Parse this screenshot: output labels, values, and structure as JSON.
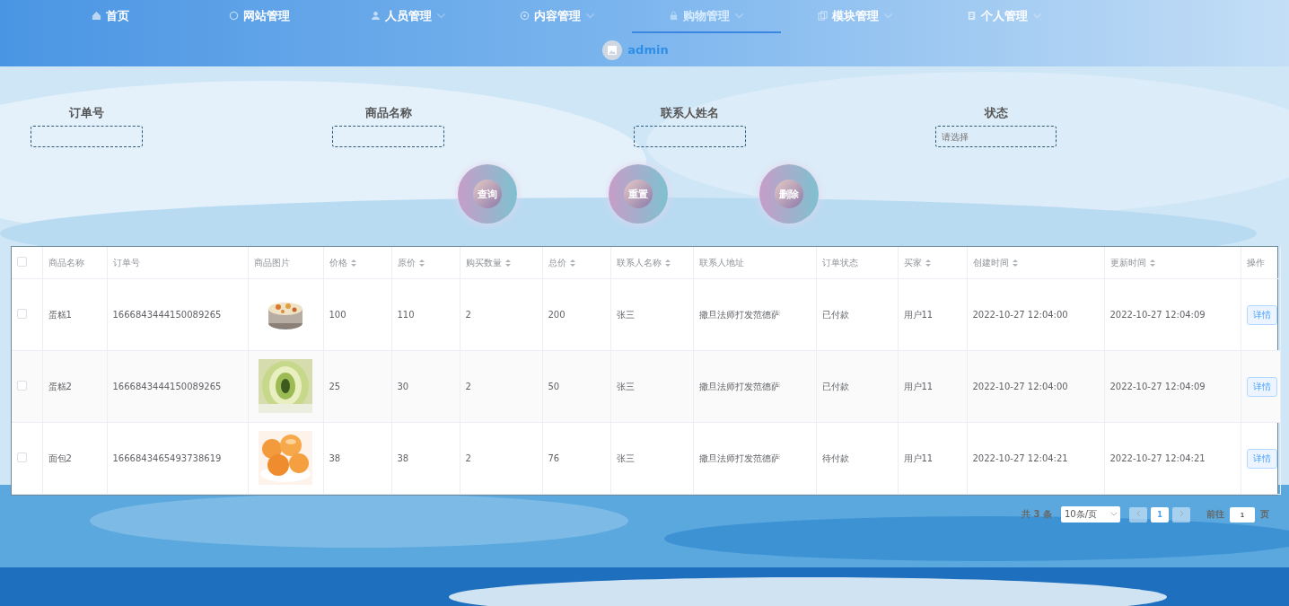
{
  "nav": {
    "items": [
      {
        "label": "首页",
        "dropdown": false,
        "selected": false
      },
      {
        "label": "网站管理",
        "dropdown": false,
        "selected": false
      },
      {
        "label": "人员管理",
        "dropdown": true,
        "selected": false
      },
      {
        "label": "内容管理",
        "dropdown": true,
        "selected": false
      },
      {
        "label": "购物管理",
        "dropdown": true,
        "selected": true
      },
      {
        "label": "模块管理",
        "dropdown": true,
        "selected": false
      },
      {
        "label": "个人管理",
        "dropdown": true,
        "selected": false
      }
    ],
    "user": "admin"
  },
  "filters": [
    {
      "label": "订单号",
      "kind": "input"
    },
    {
      "label": "商品名称",
      "kind": "input"
    },
    {
      "label": "联系人姓名",
      "kind": "input"
    },
    {
      "label": "状态",
      "kind": "select",
      "placeholder": "请选择"
    }
  ],
  "actions": [
    "查询",
    "重置",
    "删除"
  ],
  "table": {
    "all_checked": false,
    "columns": [
      {
        "label": "商品名称",
        "sortable": false
      },
      {
        "label": "订单号",
        "sortable": false
      },
      {
        "label": "商品图片",
        "sortable": false
      },
      {
        "label": "价格",
        "sortable": true
      },
      {
        "label": "原价",
        "sortable": true
      },
      {
        "label": "购买数量",
        "sortable": true
      },
      {
        "label": "总价",
        "sortable": true
      },
      {
        "label": "联系人名称",
        "sortable": true
      },
      {
        "label": "联系人地址",
        "sortable": false
      },
      {
        "label": "订单状态",
        "sortable": false
      },
      {
        "label": "买家",
        "sortable": true
      },
      {
        "label": "创建时间",
        "sortable": true
      },
      {
        "label": "更新时间",
        "sortable": true
      },
      {
        "label": "操作",
        "sortable": false
      }
    ],
    "rows": [
      {
        "checked": false,
        "cells": [
          "蛋糕1",
          "1666843444150089265",
          {
            "kind": "picture"
          },
          "100",
          "110",
          "2",
          "200",
          "张三",
          "撒旦法师打发范德萨",
          "已付款",
          "用户11",
          "2022-10-27 12:04:00",
          "2022-10-27 12:04:09"
        ],
        "action": "详情"
      },
      {
        "checked": false,
        "cells": [
          "蛋糕2",
          "1666843444150089265",
          {
            "kind": "picture"
          },
          "25",
          "30",
          "2",
          "50",
          "张三",
          "撒旦法师打发范德萨",
          "已付款",
          "用户11",
          "2022-10-27 12:04:00",
          "2022-10-27 12:04:09"
        ],
        "action": "详情"
      },
      {
        "checked": false,
        "cells": [
          "面包2",
          "1666843465493738619",
          {
            "kind": "picture"
          },
          "38",
          "38",
          "2",
          "76",
          "张三",
          "撒旦法师打发范德萨",
          "待付款",
          "用户11",
          "2022-10-27 12:04:21",
          "2022-10-27 12:04:21"
        ],
        "action": "详情"
      }
    ]
  },
  "pagination": {
    "total": "共 3 条",
    "page_size": "10条/页",
    "pages": [
      {
        "label": "1",
        "selected": true
      }
    ],
    "goto_label": "前往",
    "goto_value": "1",
    "goto_suffix": "页"
  }
}
